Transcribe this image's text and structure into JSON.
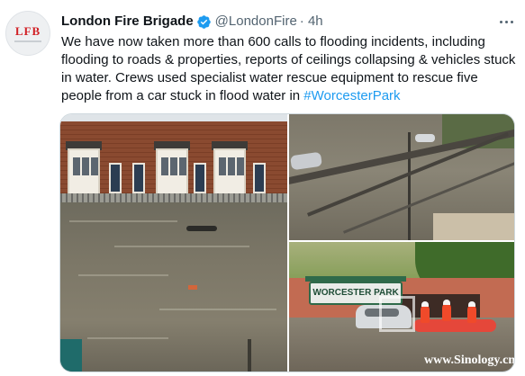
{
  "tweet": {
    "avatar": {
      "logo_text": "LFB",
      "icon": "lfb-logo-avatar"
    },
    "display_name": "London Fire Brigade",
    "verified_icon": "verified-badge-icon",
    "handle": "@LondonFire",
    "time": "· 4h",
    "more_icon": "more-options-icon",
    "body_text": "We have now taken more than 600 calls to flooding incidents, including flooding to roads & properties, reports of ceilings collapsing & vehicles stuck in water. Crews used specialist water rescue equipment to rescue five people from a car stuck in flood water in ",
    "hashtag": "#WorcesterPark"
  },
  "media": {
    "photos": [
      {
        "subject": "flooded residential street with terraced houses"
      },
      {
        "subject": "flooded road with cars seen from a railing"
      },
      {
        "subject": "firefighters rescuing people from a car under Worcester Park sign",
        "sign_text": "WORCESTER PARK"
      }
    ],
    "watermark": "www.Sinology.cn"
  },
  "colors": {
    "link": "#1d9bf0",
    "verified": "#1d9bf0",
    "text": "#0f1419",
    "secondary": "#536471",
    "lfb_red": "#d11f25"
  }
}
